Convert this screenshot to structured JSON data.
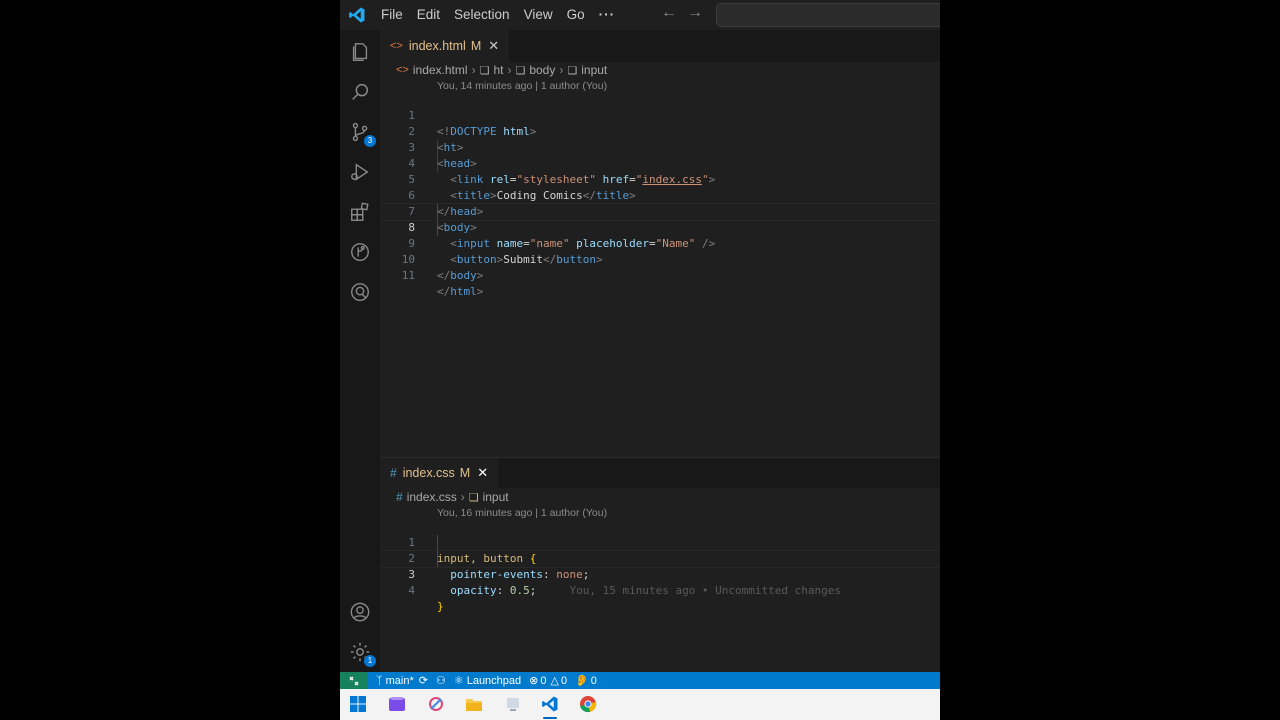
{
  "colors": {
    "accent": "#007acc",
    "modified": "#e2c08d",
    "remote": "#16825d"
  },
  "menu": [
    "File",
    "Edit",
    "Selection",
    "View",
    "Go"
  ],
  "menu_more": "···",
  "activity_bar": {
    "items": [
      "explorer-icon",
      "search-icon",
      "source-control-icon",
      "run-debug-icon",
      "extensions-icon",
      "git-graph-icon",
      "remote-explorer-icon"
    ],
    "source_control_badge": "3",
    "accounts_icon": "account-icon",
    "settings_icon": "gear-icon",
    "settings_badge": "1"
  },
  "top_editor": {
    "tab": {
      "filename": "index.html",
      "status": "M"
    },
    "breadcrumb": {
      "file": "index.html",
      "parts": [
        "ht",
        "body",
        "input"
      ]
    },
    "blame": "You, 14 minutes ago | 1 author (You)",
    "line_numbers": [
      "1",
      "2",
      "3",
      "4",
      "5",
      "6",
      "7",
      "8",
      "9",
      "10",
      "11"
    ],
    "lines": {
      "l1": {
        "open": "<!",
        "kw": "DOCTYPE",
        "attr": "html",
        "close": ">"
      },
      "l2": {
        "open": "<",
        "tag": "ht",
        "close": ">"
      },
      "l3": {
        "open": "<",
        "tag": "head",
        "close": ">"
      },
      "l4": {
        "open": "<",
        "tag": "link",
        "a1": "rel",
        "eq1": "=",
        "v1": "\"stylesheet\"",
        "a2": "href",
        "eq2": "=",
        "q1": "\"",
        "v2": "index.css",
        "q2": "\"",
        "close": ">"
      },
      "l5": {
        "open": "<",
        "tag": "title",
        "close": ">",
        "text": "Coding Comics",
        "endopen": "</",
        "endtag": "title",
        "endclose": ">"
      },
      "l6": {
        "open": "</",
        "tag": "head",
        "close": ">"
      },
      "l7": {
        "open": "<",
        "tag": "body",
        "close": ">"
      },
      "l8": {
        "open": "<",
        "tag": "input",
        "a1": "name",
        "eq1": "=",
        "v1": "\"name\"",
        "a2": "placeholder",
        "eq2": "=",
        "v2": "\"Name\"",
        "close": "/>"
      },
      "l9": {
        "open": "<",
        "tag": "button",
        "close": ">",
        "text": "Submit",
        "endopen": "</",
        "endtag": "button",
        "endclose": ">"
      },
      "l10": {
        "open": "</",
        "tag": "body",
        "close": ">"
      },
      "l11": {
        "open": "</",
        "tag": "html",
        "close": ">"
      }
    }
  },
  "bottom_editor": {
    "tab": {
      "filename": "index.css",
      "status": "M"
    },
    "breadcrumb": {
      "file": "index.css",
      "parts": [
        "input"
      ]
    },
    "blame": "You, 16 minutes ago | 1 author (You)",
    "line_numbers": [
      "1",
      "2",
      "3",
      "4"
    ],
    "lines": {
      "l1": {
        "selector": "input, button",
        "brace": " {"
      },
      "l2": {
        "prop": "pointer-events",
        "colon": ":",
        "value": "none",
        "semi": ";"
      },
      "l3": {
        "prop": "opacity",
        "colon": ":",
        "value": "0.5",
        "semi": ";",
        "ghost": "You, 15 minutes ago • Uncommitted changes"
      },
      "l4": {
        "brace": "}"
      }
    }
  },
  "statusbar": {
    "branch": "main*",
    "launchpad": "Launchpad",
    "errors": "0",
    "warnings": "0",
    "ports": "0"
  },
  "taskbar": [
    "windows-start-icon",
    "media-app-icon",
    "snipping-tool-icon",
    "file-explorer-icon",
    "app-icon",
    "vscode-icon",
    "chrome-icon"
  ]
}
